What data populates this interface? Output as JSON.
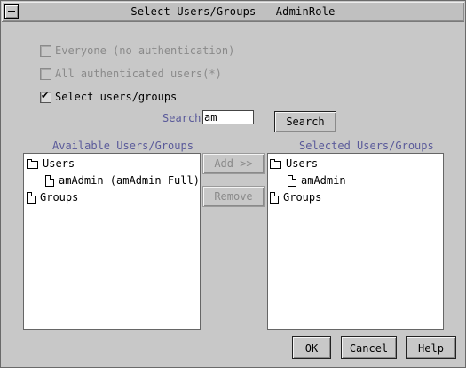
{
  "window": {
    "title": "Select Users/Groups — AdminRole"
  },
  "options": {
    "everyone": {
      "label": "Everyone (no authentication)",
      "checked": false,
      "enabled": false
    },
    "all_authenticated": {
      "label": "All authenticated users(*)",
      "checked": false,
      "enabled": false
    },
    "select_users": {
      "label": "Select users/groups",
      "checked": true,
      "enabled": true
    }
  },
  "search": {
    "label": "Search:",
    "value": "am",
    "button_label": "Search"
  },
  "available": {
    "label": "Available Users/Groups",
    "tree": [
      {
        "label": "Users",
        "type": "folder",
        "children": [
          {
            "label": "amAdmin (amAdmin Full)",
            "type": "doc"
          }
        ]
      },
      {
        "label": "Groups",
        "type": "doc"
      }
    ]
  },
  "transfer": {
    "add_label": "Add >>",
    "remove_label": "Remove"
  },
  "selected": {
    "label": "Selected Users/Groups",
    "tree": [
      {
        "label": "Users",
        "type": "folder",
        "children": [
          {
            "label": "amAdmin",
            "type": "doc"
          }
        ]
      },
      {
        "label": "Groups",
        "type": "doc"
      }
    ]
  },
  "footer": {
    "ok_label": "OK",
    "cancel_label": "Cancel",
    "help_label": "Help"
  }
}
